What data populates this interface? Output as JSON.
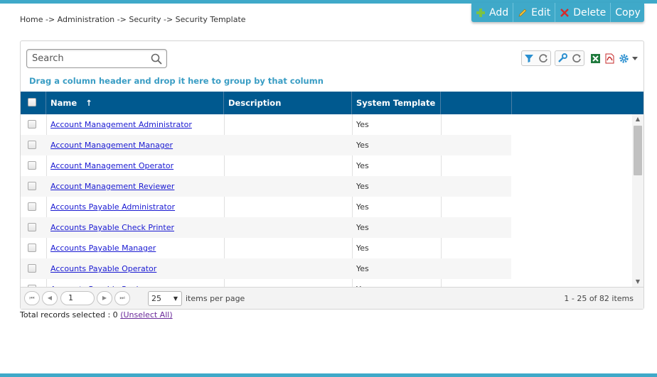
{
  "breadcrumb": "Home -> Administration -> Security -> Security Template",
  "toolbar": {
    "add_label": "Add",
    "edit_label": "Edit",
    "delete_label": "Delete",
    "copy_label": "Copy"
  },
  "search": {
    "placeholder": "Search"
  },
  "group_hint": "Drag a column header and drop it here to group by that column",
  "columns": {
    "name": "Name",
    "description": "Description",
    "system_template": "System Template"
  },
  "sort_indicator": "↑",
  "rows": [
    {
      "name": "Account Management Administrator",
      "description": "",
      "system_template": "Yes"
    },
    {
      "name": "Account Management Manager",
      "description": "",
      "system_template": "Yes"
    },
    {
      "name": "Account Management Operator",
      "description": "",
      "system_template": "Yes"
    },
    {
      "name": "Account Management Reviewer",
      "description": "",
      "system_template": "Yes"
    },
    {
      "name": "Accounts Payable Administrator",
      "description": "",
      "system_template": "Yes"
    },
    {
      "name": "Accounts Payable Check Printer",
      "description": "",
      "system_template": "Yes"
    },
    {
      "name": "Accounts Payable Manager",
      "description": "",
      "system_template": "Yes"
    },
    {
      "name": "Accounts Payable Operator",
      "description": "",
      "system_template": "Yes"
    },
    {
      "name": "Accounts Payable Reviewer",
      "description": "",
      "system_template": "Yes"
    }
  ],
  "pager": {
    "current_page": "1",
    "page_size": "25",
    "per_page_label": "items per page",
    "range_label": "1 - 25 of 82 items"
  },
  "footer": {
    "selected_text": "Total records selected : 0",
    "unselect_label": "(Unselect All)"
  },
  "icons": {
    "add": "plus-icon",
    "edit": "pencil-icon",
    "delete": "x-icon",
    "search": "magnifier-icon",
    "filter": "funnel-icon",
    "reset": "refresh-icon",
    "columns": "wrench-icon",
    "excel": "excel-icon",
    "pdf": "pdf-icon",
    "settings": "gear-icon"
  },
  "colors": {
    "accent": "#3fa9c9",
    "header_bg": "#00598f",
    "hint_text": "#3a9dc4",
    "link": "#1a1ad2"
  }
}
